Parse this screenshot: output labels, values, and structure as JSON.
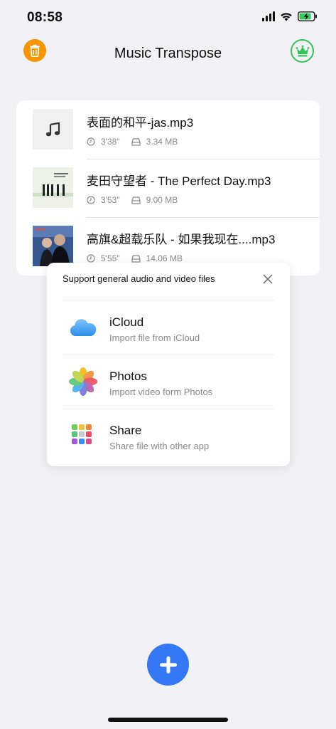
{
  "status_bar": {
    "time": "08:58"
  },
  "nav": {
    "title": "Music Transpose"
  },
  "files": [
    {
      "title": "表面的和平-jas.mp3",
      "duration": "3'38\"",
      "size": "3.34 MB",
      "thumb": "music-note"
    },
    {
      "title": "麦田守望者 - The Perfect Day.mp3",
      "duration": "3'53\"",
      "size": "9.00 MB",
      "thumb": "album-art"
    },
    {
      "title": "高旗&超载乐队 - 如果我现在....mp3",
      "duration": "5'55\"",
      "size": "14.06 MB",
      "thumb": "album-art"
    }
  ],
  "import_popup": {
    "header": "Support general audio and video files",
    "options": [
      {
        "title": "iCloud",
        "subtitle": "Import file from iCloud",
        "icon": "icloud-icon"
      },
      {
        "title": "Photos",
        "subtitle": "Import video form Photos",
        "icon": "photos-icon"
      },
      {
        "title": "Share",
        "subtitle": "Share file with other app",
        "icon": "share-apps-icon"
      }
    ]
  },
  "colors": {
    "accent": "#3478f6",
    "trash": "#f69500",
    "crown": "#32c35b",
    "background": "#f2f1f6"
  }
}
